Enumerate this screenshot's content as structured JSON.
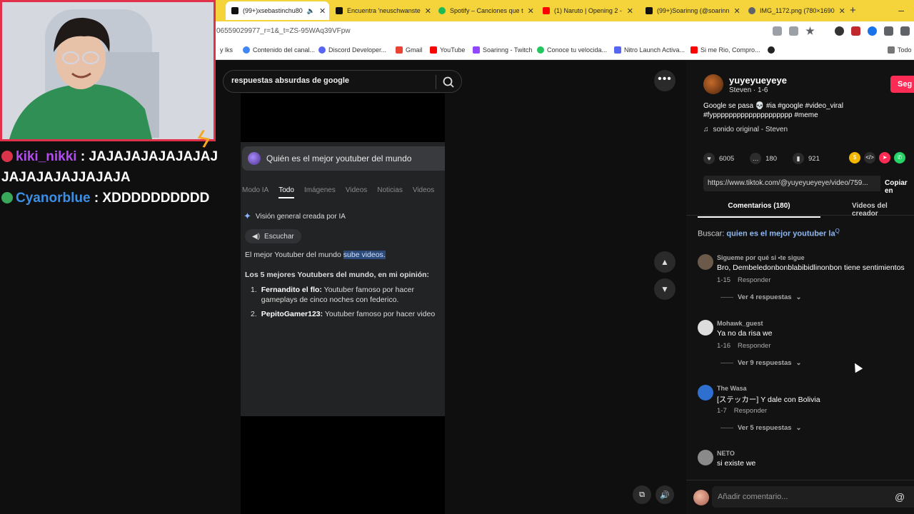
{
  "browser": {
    "tabs": [
      {
        "label": "(99+)xsebastinchu80",
        "icon": "tiktok-icon",
        "color": "#111111",
        "active": true
      },
      {
        "label": "Encuentra 'neuschwanste",
        "icon": "tiktok-icon",
        "color": "#111111"
      },
      {
        "label": "Spotify – Canciones que t",
        "icon": "spotify-icon",
        "color": "#1db954"
      },
      {
        "label": "(1) Naruto | Opening 2 -",
        "icon": "youtube-icon",
        "color": "#ff0000"
      },
      {
        "label": "(99+)Soarinng (@soarinn",
        "icon": "tiktok-icon",
        "color": "#111111"
      },
      {
        "label": "IMG_1172.png (780×1690",
        "icon": "globe-icon",
        "color": "#5f6368"
      }
    ],
    "new_tab": "+",
    "minimize": "–",
    "url": "06559029977_r=1&_t=ZS-95WAq39VFpw",
    "bookmarks": [
      {
        "label": "y lks",
        "color": "#888888"
      },
      {
        "label": "Contenido del canal...",
        "color": "#4285f4"
      },
      {
        "label": "Discord Developer...",
        "color": "#5865f2"
      },
      {
        "label": "Gmail",
        "color": "#ea4335"
      },
      {
        "label": "YouTube",
        "color": "#ff0000"
      },
      {
        "label": "Soarinng - Twitch",
        "color": "#9146ff"
      },
      {
        "label": "Conoce tu velocida...",
        "color": "#22c55e"
      },
      {
        "label": "Nitro Launch Activa...",
        "color": "#5865f2"
      },
      {
        "label": "Si me Rio, Compro...",
        "color": "#ff0000"
      }
    ],
    "all_bookmarks": "Todo"
  },
  "chat": {
    "messages": [
      {
        "user": "kiki_nikki",
        "text": "JAJAJAJAJAJAJAJJAJAJAJAJJAJAJA"
      },
      {
        "user": "Cyanorblue",
        "text": "XDDDDDDDDDD"
      }
    ],
    "colon": ":"
  },
  "search": {
    "query": "respuestas absurdas de google"
  },
  "video": {
    "question": "Quién es el mejor youtuber del mundo",
    "tabs": [
      "Modo IA",
      "Todo",
      "Imágenes",
      "Videos",
      "Noticias",
      "Videos"
    ],
    "ai_overview": "Visión general creada por IA",
    "listen": "Escuchar",
    "best_prefix": "El mejor Youtuber del mundo ",
    "best_highlight": "sube videos.",
    "list_title": "Los 5 mejores Youtubers del mundo, en mi opinión:",
    "items": [
      {
        "num": "1.",
        "name": "Fernandito el flo:",
        "text": " Youtuber famoso por hacer gameplays de cinco noches con federico."
      },
      {
        "num": "2.",
        "name": "PepitoGamer123:",
        "text": " Youtuber famoso por hacer video"
      }
    ]
  },
  "post": {
    "author": "yuyeyueyeye",
    "author_sub": "Steven · 1-6",
    "follow": "Seg",
    "description": "Google se pasa 💀 #ia #google #video_viral #fypppppppppppppppppppp #meme",
    "music": "sonido original - Steven",
    "likes": "6005",
    "comments_count": "180",
    "saves": "921",
    "link": "https://www.tiktok.com/@yuyeyueyeye/video/759...",
    "copy_link": "Copiar en",
    "tab_comments": "Comentarios (180)",
    "tab_creator": "Videos del creador",
    "search_label": "Buscar:",
    "search_query": "quien es el mejor youtuber la"
  },
  "comments": [
    {
      "user": "Sigueme por qué si •te sigue",
      "text": "Bro, Dembeledonbonblabibidlinonbon tiene sentimientos",
      "date": "1-15",
      "reply": "Responder",
      "replies": "Ver 4 respuestas",
      "color": "#6b5a4a"
    },
    {
      "user": "Mohawk_guest",
      "text": "Ya no da risa we",
      "date": "1-16",
      "reply": "Responder",
      "replies": "Ver 9 respuestas",
      "color": "#dddddd"
    },
    {
      "user": "The Wasa",
      "text": "[ステッカー] Y dale con Bolivia",
      "date": "1-7",
      "reply": "Responder",
      "replies": "Ver 5 respuestas",
      "color": "#2f6fd0"
    },
    {
      "user": "NETO",
      "text": "si existe we",
      "date": "",
      "reply": "",
      "replies": "",
      "color": "#8a8a8a"
    }
  ],
  "composer": {
    "placeholder": "Añadir comentario...",
    "mention": "@"
  }
}
